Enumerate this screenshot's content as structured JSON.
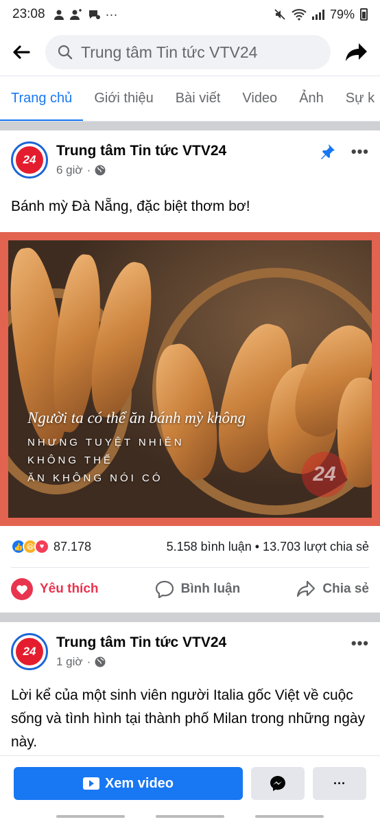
{
  "status": {
    "time": "23:08",
    "battery": "79%",
    "left_icons": [
      "user-icon",
      "add-user-icon",
      "chat-icon",
      "more-dots"
    ],
    "right_icons": [
      "mute-icon",
      "wifi-icon",
      "signal-icon",
      "battery-icon"
    ]
  },
  "header": {
    "search_text": "Trung tâm Tin tức VTV24"
  },
  "tabs": [
    {
      "label": "Trang chủ",
      "active": true
    },
    {
      "label": "Giới thiệu"
    },
    {
      "label": "Bài viết"
    },
    {
      "label": "Video"
    },
    {
      "label": "Ảnh"
    },
    {
      "label": "Sự k"
    }
  ],
  "post1": {
    "page_name": "Trung tâm Tin tức VTV24",
    "logo_text": "24",
    "time": "6 giờ",
    "text": "Bánh mỳ Đà Nẵng, đặc biệt thơm bơ!",
    "image_caption_line1": "Người ta có thể ăn bánh mỳ không",
    "image_caption_line2": "NHƯNG TUYỆT NHIÊN",
    "image_caption_line3": "KHÔNG THỂ",
    "image_caption_line4": "ĂN KHÔNG NÓI CÓ",
    "watermark": "24",
    "reaction_count": "87.178",
    "comments_shares": "5.158 bình luận • 13.703 lượt chia sẻ",
    "actions": {
      "like": "Yêu thích",
      "comment": "Bình luận",
      "share": "Chia sẻ"
    }
  },
  "post2": {
    "page_name": "Trung tâm Tin tức VTV24",
    "logo_text": "24",
    "time": "1 giờ",
    "text": "Lời kể của một sinh viên người Italia gốc Việt về cuộc sống và tình hình tại thành phố Milan trong những ngày này."
  },
  "bottom": {
    "watch_video": "Xem video",
    "more": "···"
  },
  "colors": {
    "accent": "#1877f2",
    "love": "#e8344e",
    "media_border": "#e16350"
  }
}
